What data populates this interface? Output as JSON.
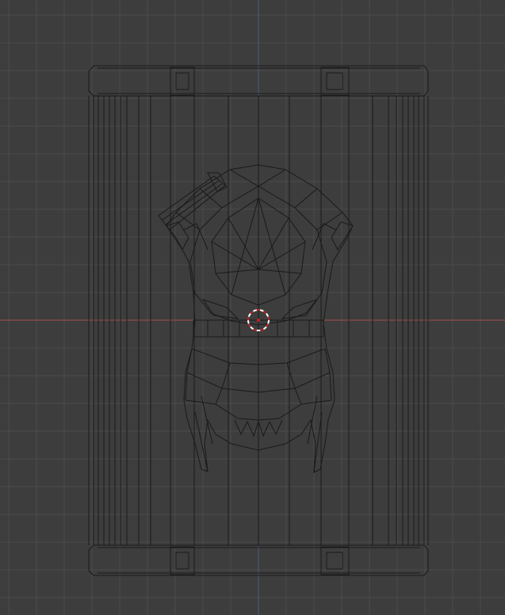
{
  "viewport": {
    "background_color": "#3d3d3d",
    "grid_color": "#4a4a4a",
    "x_axis_color": "#a85050",
    "y_axis_color": "#505a88",
    "wire_color": "#1a1a1a",
    "cursor_colors": [
      "#ffffff",
      "#c42020"
    ],
    "show_grid": true,
    "objects": [
      "wireframe-cage",
      "wireframe-character"
    ],
    "cursor_icon": "3d-cursor-icon"
  }
}
